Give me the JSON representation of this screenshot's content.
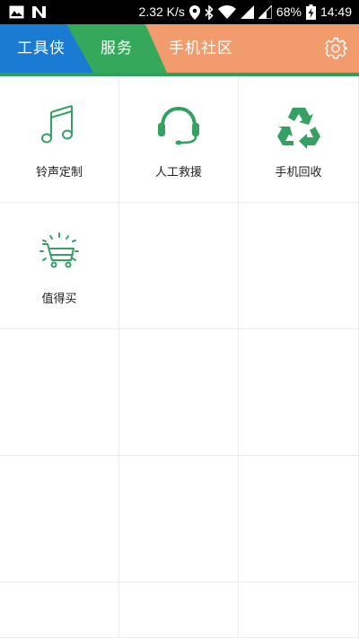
{
  "status_bar": {
    "speed": "2.32 K/s",
    "battery": "68%",
    "time": "14:49"
  },
  "tabs": {
    "tools": "工具侠",
    "service": "服务",
    "community": "手机社区"
  },
  "colors": {
    "tab_tools": "#1A7BD2",
    "tab_service": "#36A85C",
    "tab_bar": "#F29B6C",
    "accent_line": "#2DA05A",
    "icon_green": "#34A162"
  },
  "services": [
    {
      "label": "铃声定制",
      "icon": "music-note-icon"
    },
    {
      "label": "人工救援",
      "icon": "headset-icon"
    },
    {
      "label": "手机回收",
      "icon": "recycle-icon"
    },
    {
      "label": "值得买",
      "icon": "shopping-cart-icon"
    }
  ]
}
